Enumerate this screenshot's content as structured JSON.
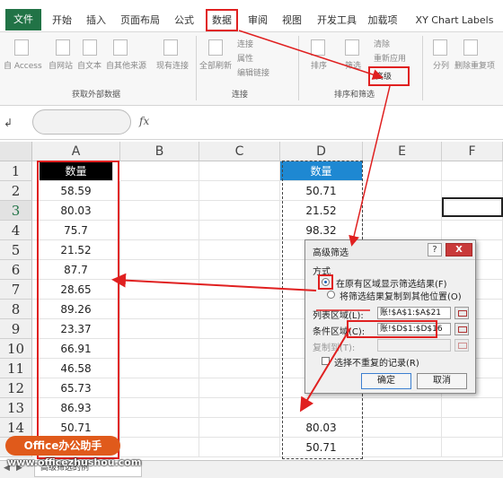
{
  "ribbon_tabs": [
    "文件",
    "开始",
    "插入",
    "页面布局",
    "公式",
    "数据",
    "审阅",
    "视图",
    "开发工具",
    "加载项",
    "XY Chart Labels"
  ],
  "ribbon": {
    "get_external": [
      "自 Access",
      "自网站",
      "自文本",
      "自其他来源",
      "现有连接"
    ],
    "get_external_label": "获取外部数据",
    "refresh_all": "全部刷新",
    "connections_items": [
      "连接",
      "属性",
      "编辑链接"
    ],
    "connections_label": "连接",
    "sort_label": "排序",
    "filter_label": "筛选",
    "clear_label": "清除",
    "reapply_label": "重新应用",
    "advanced_label": "高级",
    "sort_filter_group": "排序和筛选",
    "split_label": "分列",
    "remove_dup_label": "删除重复项"
  },
  "formula_bar": {
    "name_box": "",
    "fx": "fx"
  },
  "columns": [
    "A",
    "B",
    "C",
    "D",
    "E",
    "F"
  ],
  "rows": [
    "1",
    "2",
    "3",
    "4",
    "5",
    "6",
    "7",
    "8",
    "9",
    "10",
    "11",
    "12",
    "13",
    "14",
    "15"
  ],
  "selected_row": "3",
  "col_a": [
    "数量",
    "58.59",
    "80.03",
    "75.7",
    "21.52",
    "87.7",
    "28.65",
    "89.26",
    "23.37",
    "66.91",
    "46.58",
    "65.73",
    "86.93",
    "50.71",
    "95.79"
  ],
  "col_d_top": [
    "数量",
    "50.71",
    "21.52",
    "98.32"
  ],
  "col_d_bottom": [
    "80.03",
    "50.71"
  ],
  "dialog": {
    "title": "高级筛选",
    "help": "?",
    "close": "X",
    "mode_label": "方式",
    "opt_in_place": "在原有区域显示筛选结果(F)",
    "opt_copy": "将筛选结果复制到其他位置(O)",
    "list_range_label": "列表区域(L):",
    "list_range_value": "账!$A$1:$A$21",
    "criteria_label": "条件区域(C):",
    "criteria_value": "账!$D$1:$D$16",
    "copy_to_label": "复制到(T):",
    "unique_label": "选择不重复的记录(R)",
    "ok": "确定",
    "cancel": "取消"
  },
  "sheet_tab": "高级筛选的例",
  "watermark": {
    "logo": "Office办公助手",
    "url": "www.officezhushou.com"
  },
  "colors": {
    "accent_red": "#e02020",
    "excel_green": "#217346",
    "header_blue": "#1e88d2"
  }
}
